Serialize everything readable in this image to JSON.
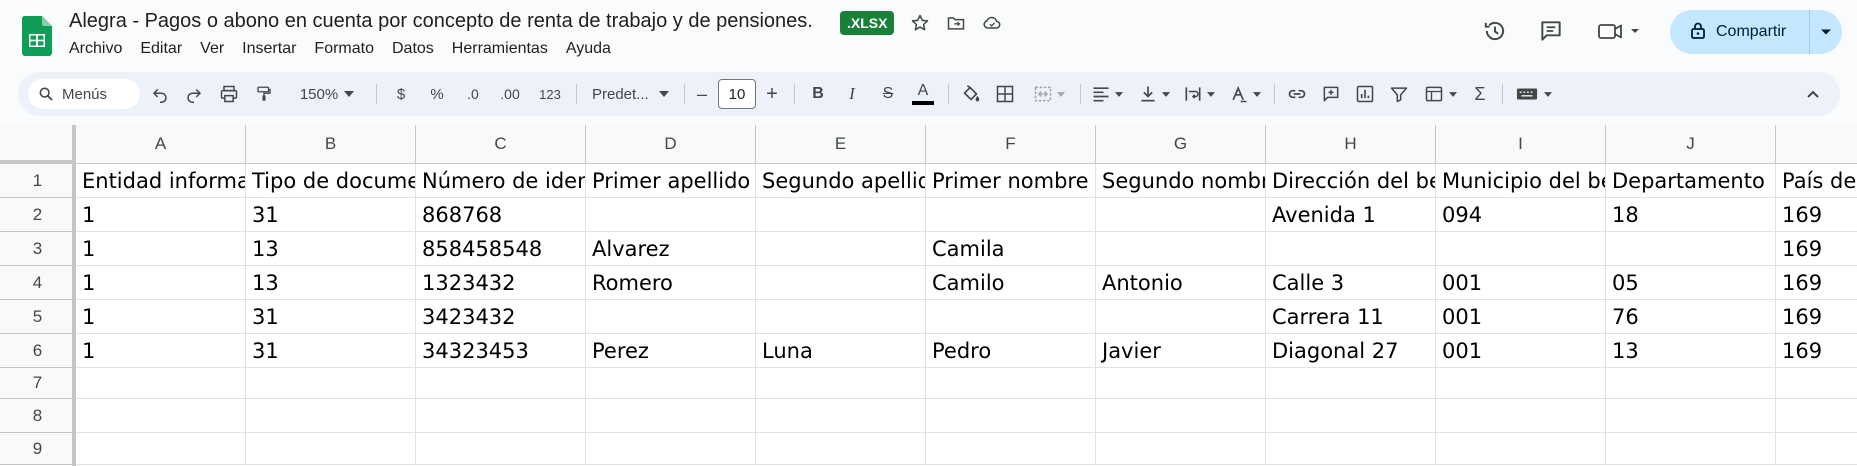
{
  "doc": {
    "title": "Alegra - Pagos o abono en cuenta por concepto de renta de trabajo y de pensiones.",
    "badge": ".XLSX"
  },
  "menu": [
    "Archivo",
    "Editar",
    "Ver",
    "Insertar",
    "Formato",
    "Datos",
    "Herramientas",
    "Ayuda"
  ],
  "share": {
    "label": "Compartir"
  },
  "toolbar": {
    "search_label": "Menús",
    "zoom": "150%",
    "currency": "$",
    "percent": "%",
    "dec_less": ".0",
    "dec_more": ".00",
    "number_format": "123",
    "font": "Predet...",
    "font_size": "10",
    "minus": "–",
    "plus": "+",
    "bold": "B",
    "italic": "I",
    "strike": "S",
    "text_color": "A",
    "sigma": "Σ"
  },
  "colors": {
    "brand_green": "#188038",
    "share_bg": "#c2e7ff",
    "toolbar_bg": "#edf2fa"
  },
  "grid": {
    "columns": [
      "A",
      "B",
      "C",
      "D",
      "E",
      "F",
      "G",
      "H",
      "I",
      "J",
      ""
    ],
    "rows": [
      [
        "Entidad informante",
        "Tipo de documento",
        "Número de identificación",
        "Primer apellido",
        "Segundo apellido",
        "Primer nombre",
        "Segundo nombre",
        "Dirección del beneficiario",
        "Municipio del beneficiario",
        "Departamento",
        "País de residencia"
      ],
      [
        "1",
        "31",
        "868768",
        "",
        "",
        "",
        "",
        "Avenida 1",
        "094",
        "18",
        "169"
      ],
      [
        "1",
        "13",
        "858458548",
        "Alvarez",
        "",
        "Camila",
        "",
        "",
        "",
        "",
        "169"
      ],
      [
        "1",
        "13",
        "1323432",
        "Romero",
        "",
        "Camilo",
        "Antonio",
        "Calle 3",
        "001",
        "05",
        "169"
      ],
      [
        "1",
        "31",
        "3423432",
        "",
        "",
        "",
        "",
        "Carrera 11",
        "001",
        "76",
        "169"
      ],
      [
        "1",
        "31",
        "34323453",
        "Perez",
        "Luna",
        "Pedro",
        "Javier",
        "Diagonal 27",
        "001",
        "13",
        "169"
      ],
      [
        "",
        "",
        "",
        "",
        "",
        "",
        "",
        "",
        "",
        "",
        ""
      ],
      [
        "",
        "",
        "",
        "",
        "",
        "",
        "",
        "",
        "",
        "",
        ""
      ],
      [
        "",
        "",
        "",
        "",
        "",
        "",
        "",
        "",
        "",
        "",
        ""
      ]
    ],
    "row_numbers": [
      "1",
      "2",
      "3",
      "4",
      "5",
      "6",
      "7",
      "8",
      "9"
    ]
  }
}
